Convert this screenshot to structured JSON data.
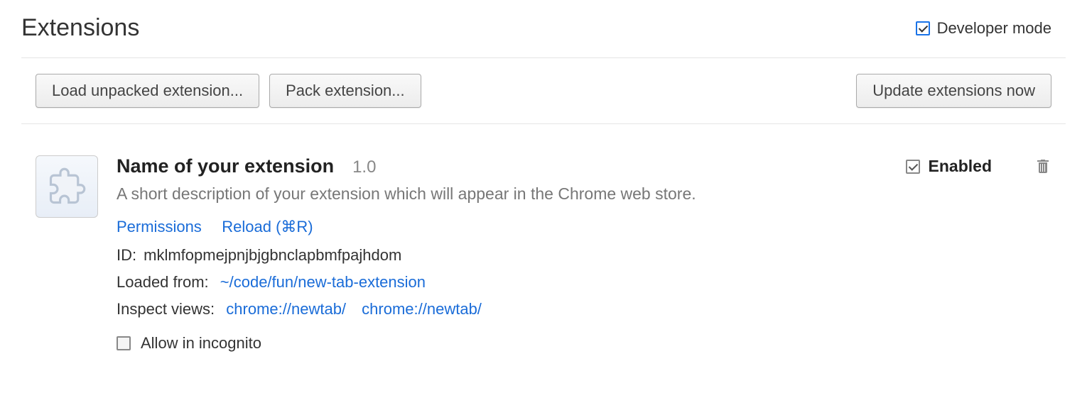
{
  "header": {
    "title": "Extensions",
    "dev_mode_label": "Developer mode"
  },
  "toolbar": {
    "load_unpacked": "Load unpacked extension...",
    "pack_extension": "Pack extension...",
    "update_now": "Update extensions now"
  },
  "extension": {
    "name": "Name of your extension",
    "version": "1.0",
    "description": "A short description of your extension which will appear in the Chrome web store.",
    "permissions_link": "Permissions",
    "reload_link": "Reload (⌘R)",
    "id_label": "ID:",
    "id_value": "mklmfopmejpnjbjgbnclapbmfpajhdom",
    "loaded_from_label": "Loaded from:",
    "loaded_from_value": "~/code/fun/new-tab-extension",
    "inspect_views_label": "Inspect views:",
    "inspect_views": [
      "chrome://newtab/",
      "chrome://newtab/"
    ],
    "allow_incognito_label": "Allow in incognito",
    "enabled_label": "Enabled"
  }
}
